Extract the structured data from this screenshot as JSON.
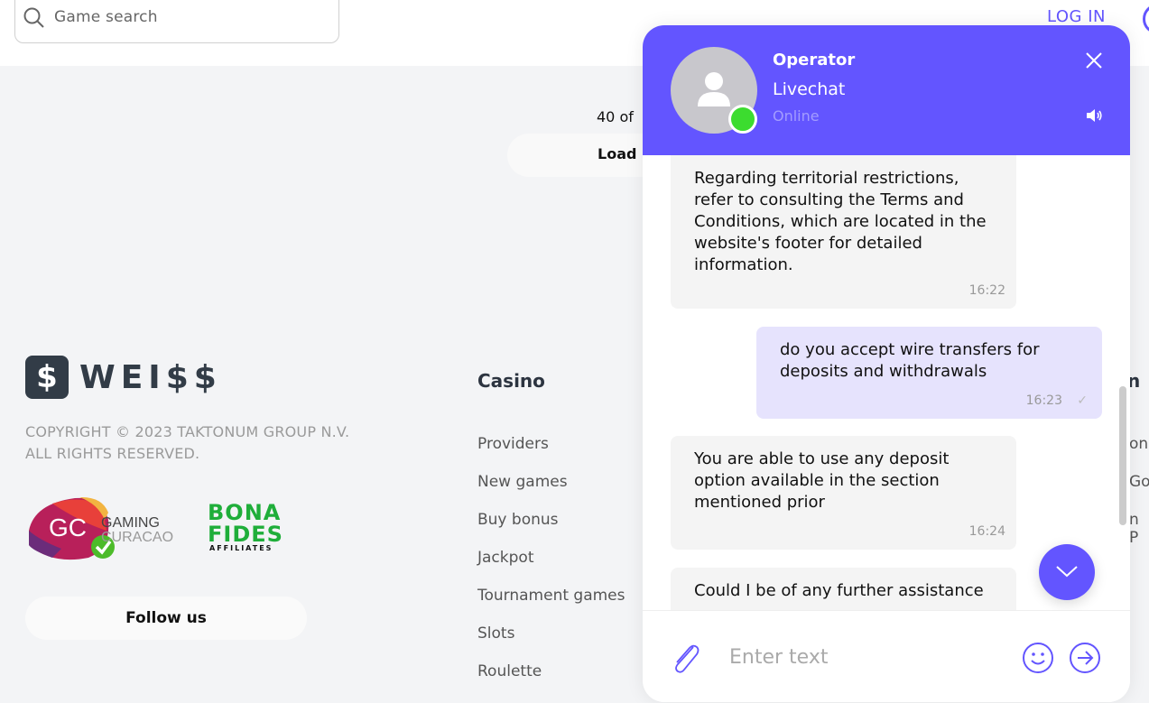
{
  "header": {
    "search_placeholder": "Game search",
    "login_label": "LOG IN"
  },
  "games": {
    "count_text": "40 of",
    "load_label": "Load"
  },
  "footer": {
    "brand_glyph": "$",
    "brand_name": "WEI$$",
    "copyright": "COPYRIGHT © 2023 TAKTONUM GROUP N.V. ALL RIGHTS RESERVED.",
    "license_logo": {
      "abbr": "GC",
      "line1": "GAMING",
      "line2": "CURACAO"
    },
    "affiliate_logo": {
      "line1": "BONA",
      "line2": "FIDES",
      "line3": "AFFILIATES"
    },
    "follow_label": "Follow us",
    "casino_column": {
      "title": "Casino",
      "links": [
        "Providers",
        "New games",
        "Buy bonus",
        "Jackpot",
        "Tournament games",
        "Slots",
        "Roulette"
      ]
    },
    "partial_column": {
      "title": "n",
      "links": [
        "on",
        "Go",
        "n P"
      ]
    }
  },
  "chat": {
    "operator_name": "Operator",
    "operator_subtitle": "Livechat",
    "operator_status": "Online",
    "accent_color": "#6355ff",
    "status_color": "#3cdc2f",
    "messages": [
      {
        "from": "operator",
        "text": "Regarding territorial restrictions, refer to consulting the Terms and Conditions, which are located in the website's footer for detailed information.",
        "time": "16:22"
      },
      {
        "from": "user",
        "text": "do you accept wire transfers for deposits and withdrawals",
        "time": "16:23",
        "status": "sent"
      },
      {
        "from": "operator",
        "text": "You are able to use any deposit option available in the section mentioned prior",
        "time": "16:24"
      },
      {
        "from": "operator",
        "text": "Could I be of any further assistance",
        "time": ""
      }
    ],
    "input_placeholder": "Enter text"
  }
}
